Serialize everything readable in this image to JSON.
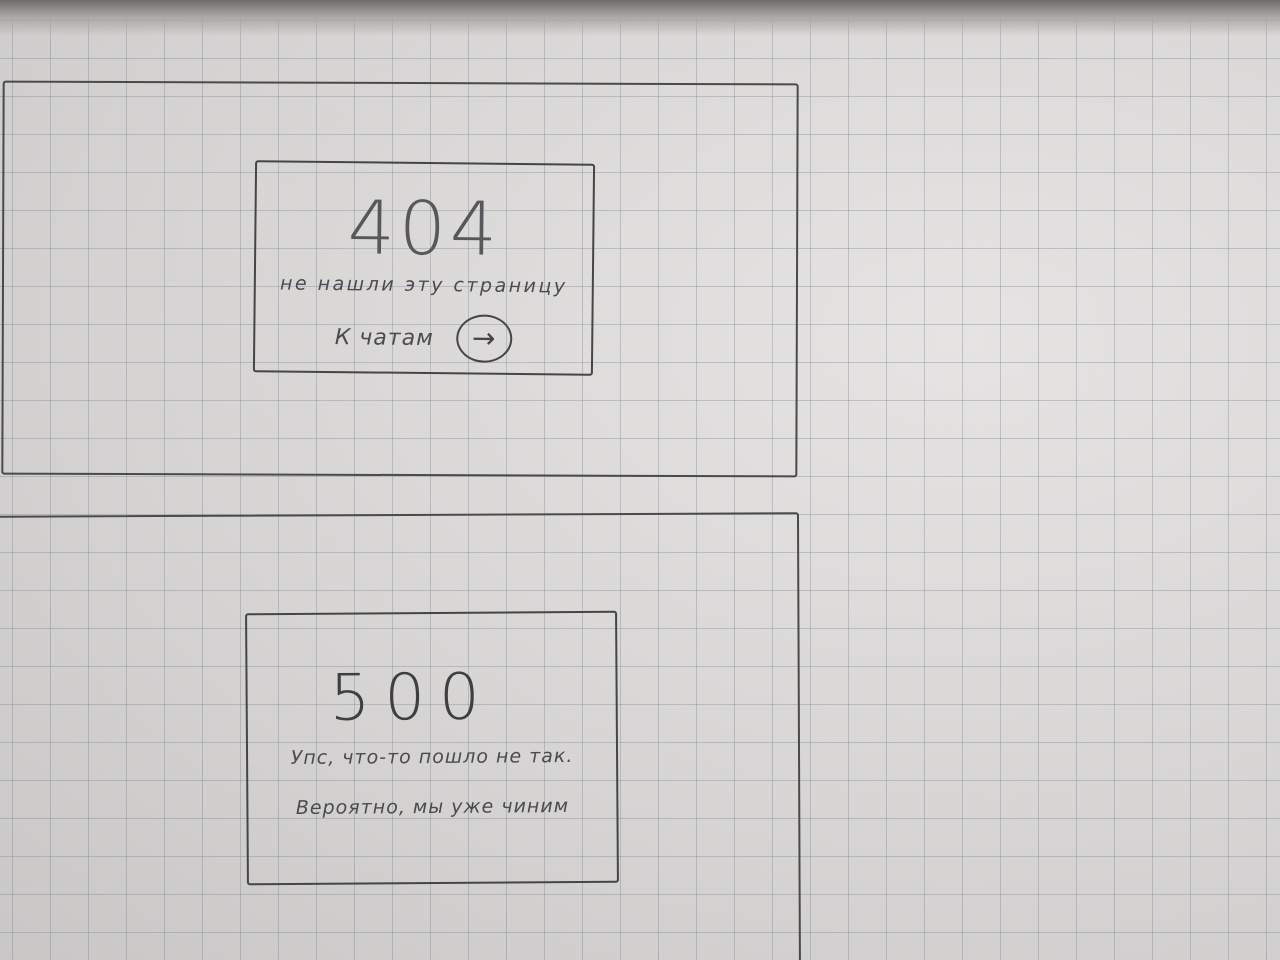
{
  "sketch": {
    "screens": [
      {
        "id": "not-found",
        "code": "404",
        "message": "не нашли эту страницу",
        "action": {
          "label": "К чатам",
          "icon": "arrow-right-circle-icon"
        }
      },
      {
        "id": "server-error",
        "code": "500",
        "message": "Упс, что-то пошло не так.",
        "submessage": "Вероятно, мы уже чиним"
      }
    ]
  },
  "colors": {
    "paper": "#dcdad9",
    "grid": "#787d8c",
    "pencil": "#4a4a4c"
  }
}
